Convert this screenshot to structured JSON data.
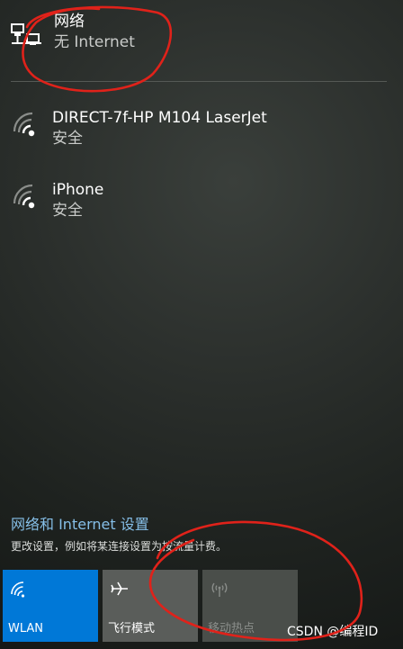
{
  "wired": {
    "title": "网络",
    "status": "无 Internet"
  },
  "wifi": [
    {
      "name": "DIRECT-7f-HP M104 LaserJet",
      "security": "安全"
    },
    {
      "name": "iPhone",
      "security": "安全"
    }
  ],
  "settings": {
    "link": "网络和 Internet 设置",
    "description": "更改设置，例如将某连接设置为按流量计费。"
  },
  "tiles": {
    "wlan": {
      "label": "WLAN",
      "active": true
    },
    "airplane": {
      "label": "飞行模式",
      "active": false
    },
    "hotspot": {
      "label": "移动热点",
      "active": false,
      "disabled": true
    }
  },
  "watermark": "CSDN @编程ID",
  "colors": {
    "accent": "#0078d7",
    "annotation": "#e0221a"
  },
  "icons": {
    "wired": "ethernet-icon",
    "wifi": "wifi-secured-icon",
    "airplane": "airplane-icon",
    "hotspot": "hotspot-icon"
  }
}
